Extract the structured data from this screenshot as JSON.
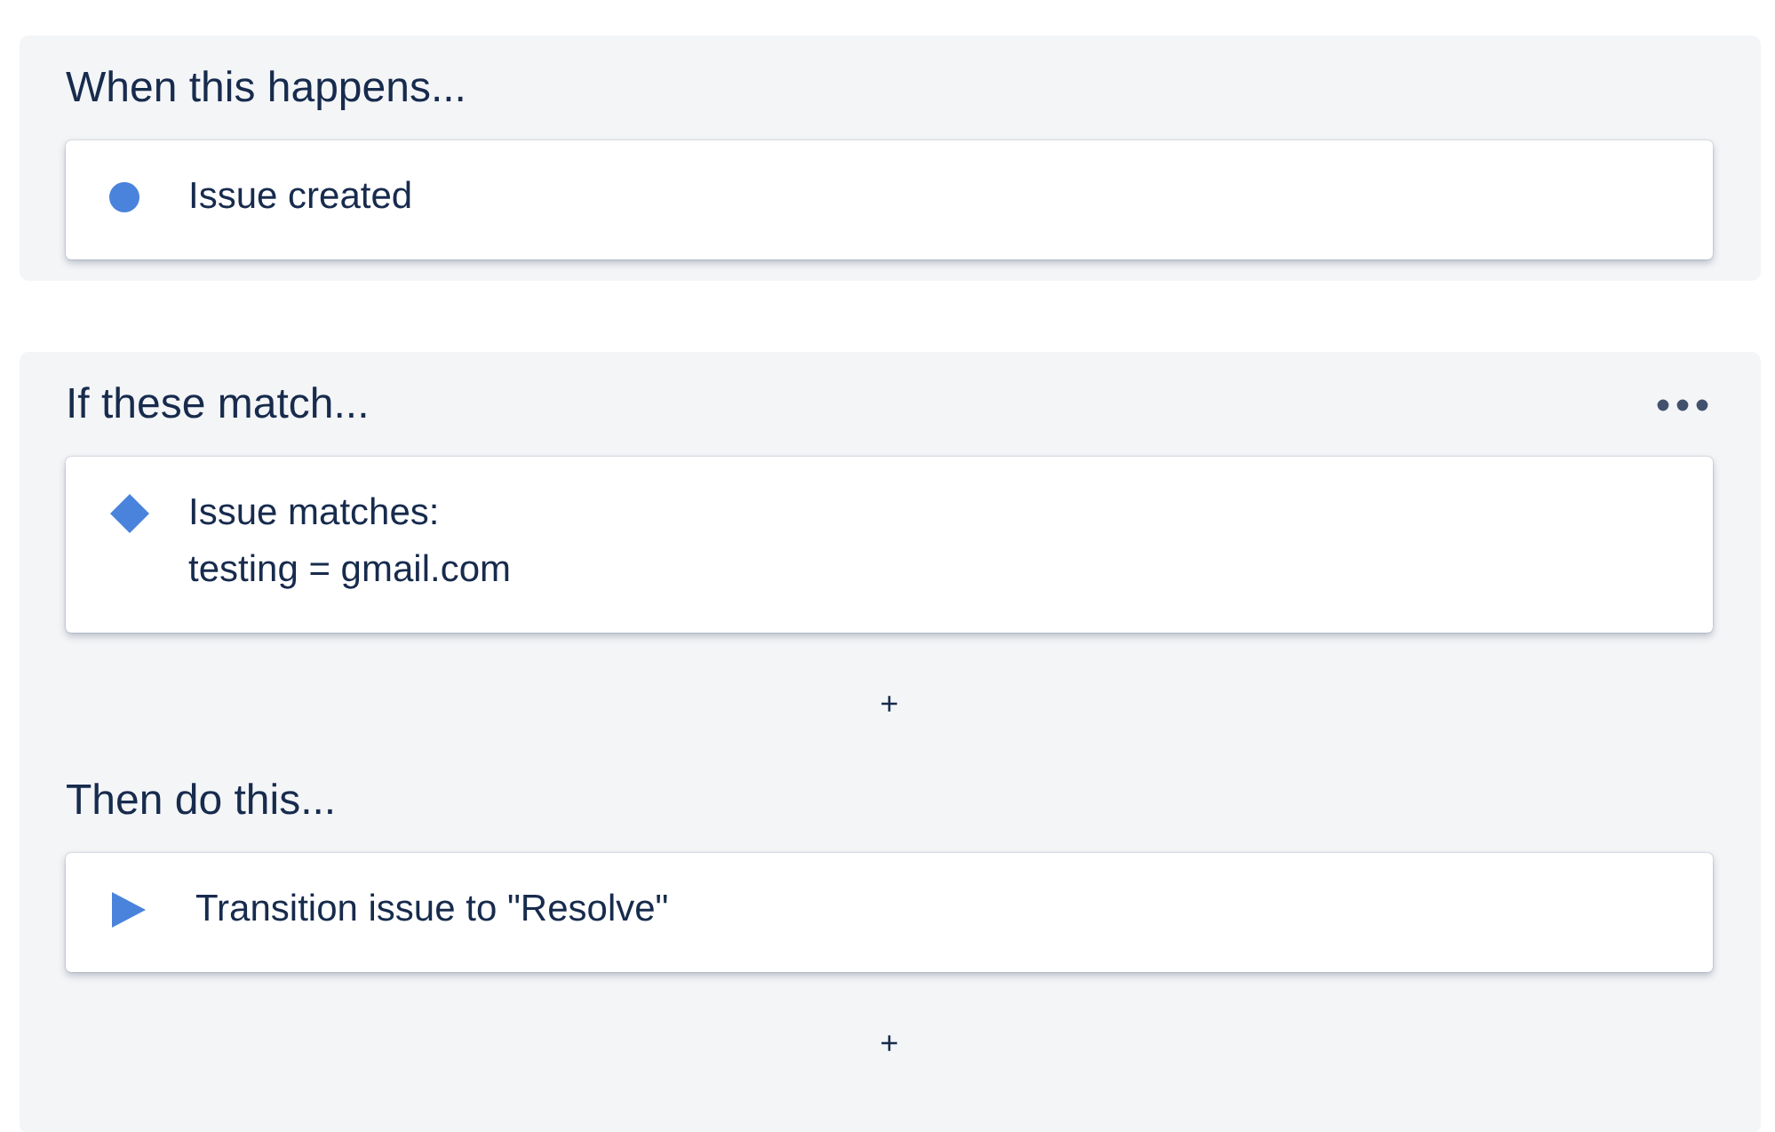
{
  "panels": [
    {
      "groups": [
        {
          "title": "When this happens...",
          "menu": false,
          "items": [
            {
              "kind": "trigger",
              "lines": [
                "Issue created"
              ]
            }
          ]
        }
      ]
    },
    {
      "groups": [
        {
          "title": "If these match...",
          "menu": true,
          "items": [
            {
              "kind": "condition",
              "lines": [
                "Issue matches:",
                "testing = gmail.com"
              ]
            }
          ],
          "add_button": "+"
        },
        {
          "title": "Then do this...",
          "menu": false,
          "items": [
            {
              "kind": "action",
              "lines": [
                "Transition issue to \"Resolve\""
              ]
            }
          ],
          "add_button": "+"
        }
      ]
    }
  ]
}
